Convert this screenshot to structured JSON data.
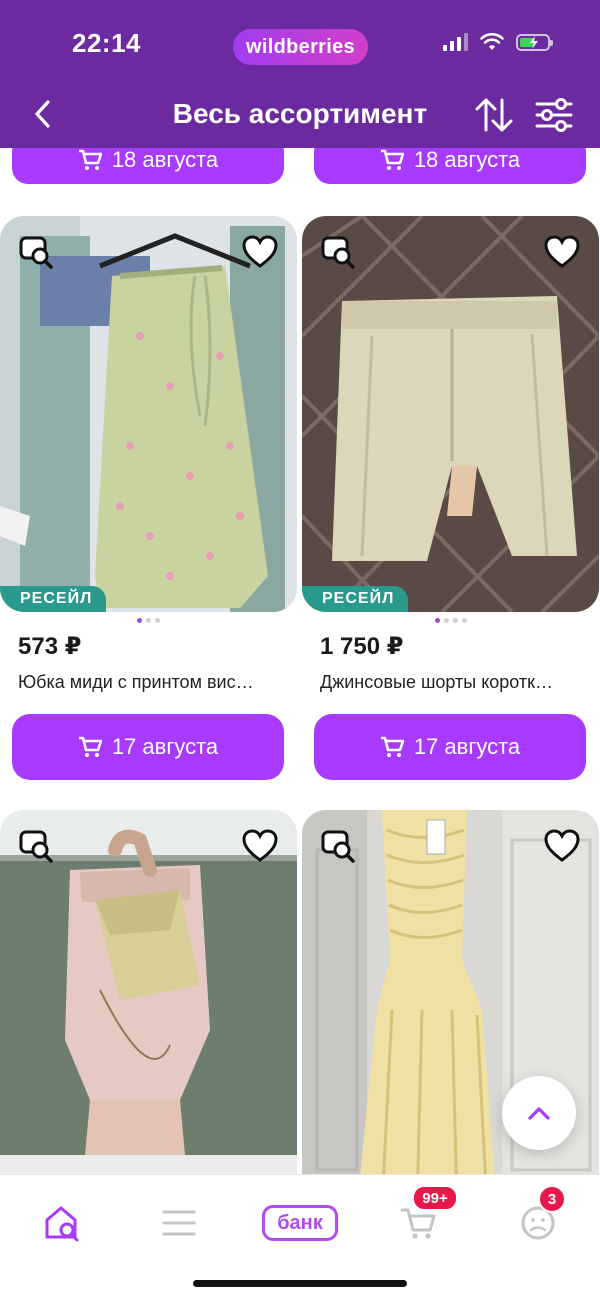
{
  "status_bar": {
    "time": "22:14",
    "brand": "wildberries"
  },
  "header": {
    "title": "Весь ассортимент"
  },
  "previous_row": {
    "buttons": [
      {
        "label": "18 августа"
      },
      {
        "label": "18 августа"
      }
    ]
  },
  "products": [
    {
      "badge": "РЕСЕЙЛ",
      "price": "573 ₽",
      "name": "Юбка миди с принтом вис…",
      "delivery": "17 августа",
      "photo_index": {
        "active": 1,
        "total": 3
      }
    },
    {
      "badge": "РЕСЕЙЛ",
      "price": "1 750 ₽",
      "name": "Джинсовые шорты коротк…",
      "delivery": "17 августа",
      "photo_index": {
        "active": 1,
        "total": 4
      }
    },
    {
      "badge": "",
      "price": "",
      "name": "",
      "delivery": ""
    },
    {
      "badge": "",
      "price": "",
      "name": "",
      "delivery": ""
    }
  ],
  "bottom_nav": {
    "items": [
      {
        "icon": "home-search-icon"
      },
      {
        "icon": "catalog-menu-icon"
      },
      {
        "label": "банк"
      },
      {
        "icon": "cart-icon",
        "badge": "99+"
      },
      {
        "icon": "profile-icon",
        "badge": "3"
      }
    ]
  },
  "colors": {
    "header": "#6b2aa0",
    "button": "#a73afd",
    "resale_badge": "#2a9a8c",
    "badge": "#e8194a",
    "nav_active": "#b24cf2"
  }
}
